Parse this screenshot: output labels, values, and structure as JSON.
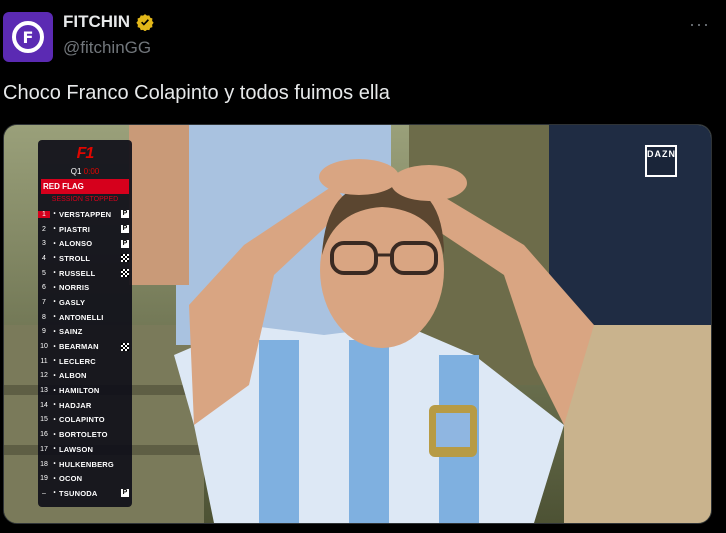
{
  "tweet": {
    "display_name": "FITCHIN",
    "handle": "@fitchinGG",
    "avatar_letter": "F",
    "text": "Choco Franco Colapinto y todos fuimos ella",
    "more_label": "···"
  },
  "media": {
    "broadcaster_logo": "DAZN",
    "f1_logo": "F1",
    "session": "Q1",
    "session_time": "0:00",
    "flag_status": "RED FLAG",
    "session_status": "SESSION STOPPED",
    "standings": [
      {
        "pos": "1",
        "driver": "VERSTAPPEN",
        "flag": "P"
      },
      {
        "pos": "2",
        "driver": "PIASTRI",
        "flag": "P"
      },
      {
        "pos": "3",
        "driver": "ALONSO",
        "flag": "P"
      },
      {
        "pos": "4",
        "driver": "STROLL",
        "flag": "C"
      },
      {
        "pos": "5",
        "driver": "RUSSELL",
        "flag": "C"
      },
      {
        "pos": "6",
        "driver": "NORRIS",
        "flag": ""
      },
      {
        "pos": "7",
        "driver": "GASLY",
        "flag": ""
      },
      {
        "pos": "8",
        "driver": "ANTONELLI",
        "flag": ""
      },
      {
        "pos": "9",
        "driver": "SAINZ",
        "flag": ""
      },
      {
        "pos": "10",
        "driver": "BEARMAN",
        "flag": "C"
      },
      {
        "pos": "11",
        "driver": "LECLERC",
        "flag": ""
      },
      {
        "pos": "12",
        "driver": "ALBON",
        "flag": ""
      },
      {
        "pos": "13",
        "driver": "HAMILTON",
        "flag": ""
      },
      {
        "pos": "14",
        "driver": "HADJAR",
        "flag": ""
      },
      {
        "pos": "15",
        "driver": "COLAPINTO",
        "flag": ""
      },
      {
        "pos": "16",
        "driver": "BORTOLETO",
        "flag": ""
      },
      {
        "pos": "17",
        "driver": "LAWSON",
        "flag": ""
      },
      {
        "pos": "18",
        "driver": "HULKENBERG",
        "flag": ""
      },
      {
        "pos": "19",
        "driver": "OCON",
        "flag": ""
      },
      {
        "pos": "–",
        "driver": "TSUNODA",
        "flag": "P"
      }
    ]
  },
  "colors": {
    "background": "#000000",
    "avatar_bg": "#5b2ab3",
    "verified_badge": "#e2b719",
    "red_flag": "#d6001c"
  },
  "icons": {
    "verified": "verified-badge-icon",
    "more": "more-options-icon"
  }
}
